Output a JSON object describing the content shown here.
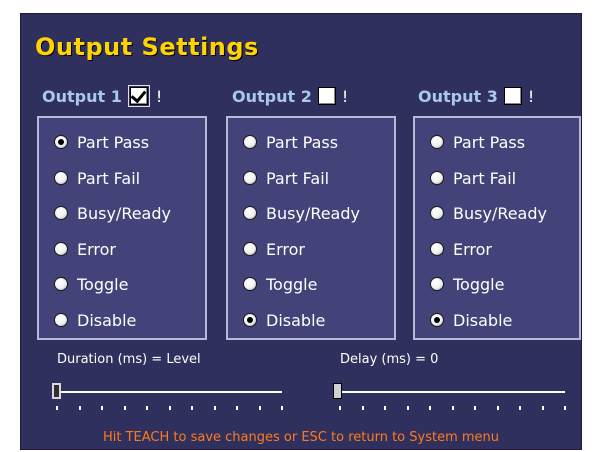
{
  "title": "Output Settings",
  "outputs": [
    {
      "label": "Output 1",
      "checked": true,
      "bang": "!",
      "selected": "Part Pass"
    },
    {
      "label": "Output 2",
      "checked": false,
      "bang": "!",
      "selected": "Disable"
    },
    {
      "label": "Output 3",
      "checked": false,
      "bang": "!",
      "selected": "Disable"
    }
  ],
  "options": [
    "Part Pass",
    "Part Fail",
    "Busy/Ready",
    "Error",
    "Toggle",
    "Disable"
  ],
  "duration": {
    "label": "Duration (ms) = ",
    "value": "Level"
  },
  "delay": {
    "label": "Delay (ms) = ",
    "value": "0"
  },
  "footer": "Hit TEACH to save changes or ESC to return to System menu",
  "colors": {
    "background": "#30305f",
    "title": "#ffd400",
    "header": "#a9c8ea",
    "footer": "#ff7a1a"
  }
}
